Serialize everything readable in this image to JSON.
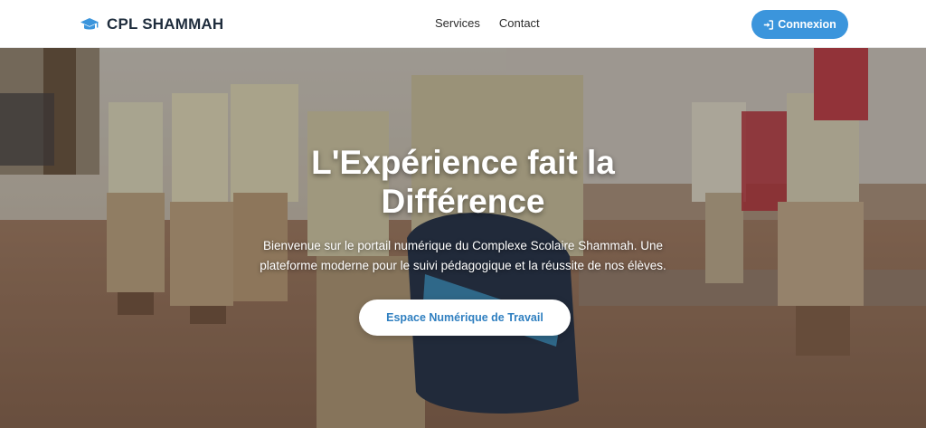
{
  "navbar": {
    "brand": {
      "name": "CPL SHAMMAH",
      "icon": "graduation-cap-icon"
    },
    "links": [
      {
        "label": "Services"
      },
      {
        "label": "Contact"
      }
    ],
    "login": {
      "label": "Connexion",
      "icon": "sign-in-icon"
    }
  },
  "hero": {
    "title": "L'Expérience fait la Différence",
    "subtitle": "Bienvenue sur le portail numérique du Complexe Scolaire Shammah. Une plateforme moderne pour le suivi pédagogique et la réussite de nos élèves.",
    "cta_label": "Espace Numérique de Travail"
  },
  "colors": {
    "accent": "#3b95dc",
    "brand_text": "#1f2d3d",
    "cta_text": "#2f7fc0"
  }
}
